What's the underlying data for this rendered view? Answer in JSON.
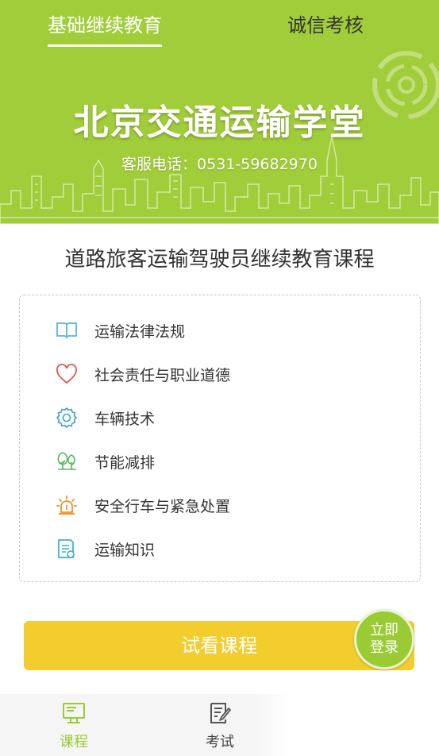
{
  "header": {
    "tabs": [
      {
        "label": "基础继续教育",
        "active": true
      },
      {
        "label": "诚信考核",
        "active": false
      }
    ],
    "brand_title": "北京交通运输学堂",
    "hotline": "客服电话：0531-59682970",
    "background_color": "#a2cd3b"
  },
  "main": {
    "course_title": "道路旅客运输驾驶员继续教育课程",
    "modules": [
      {
        "label": "运输法律法规",
        "icon": "book-icon",
        "color": "#5bb6d6"
      },
      {
        "label": "社会责任与职业道德",
        "icon": "heart-icon",
        "color": "#e2564f"
      },
      {
        "label": "车辆技术",
        "icon": "gear-icon",
        "color": "#3e9fd3"
      },
      {
        "label": "节能减排",
        "icon": "tree-icon",
        "color": "#58b85d"
      },
      {
        "label": "安全行车与紧急处置",
        "icon": "alarm-light-icon",
        "color": "#f0922f"
      },
      {
        "label": "运输知识",
        "icon": "document-icon",
        "color": "#3cb0c8"
      }
    ],
    "trial_button": "试看课程",
    "login_button_line1": "立即",
    "login_button_line2": "登录",
    "accent_yellow": "#f2cd2d",
    "accent_green": "#9acb34"
  },
  "bottom_nav": {
    "items": [
      {
        "label": "课程",
        "icon": "monitor-icon",
        "active": true
      },
      {
        "label": "考试",
        "icon": "edit-document-icon",
        "active": false
      }
    ]
  }
}
